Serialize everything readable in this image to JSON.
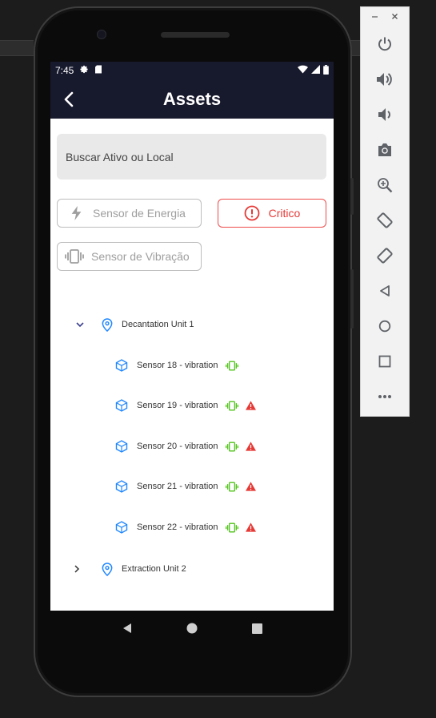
{
  "statusbar": {
    "time": "7:45"
  },
  "appbar": {
    "title": "Assets"
  },
  "search": {
    "placeholder": "Buscar Ativo ou Local"
  },
  "filters": {
    "energy_label": "Sensor de Energia",
    "critico_label": "Critico",
    "vibration_label": "Sensor de Vibração"
  },
  "tree": {
    "location1": "Decantation Unit 1",
    "sensors": [
      {
        "label": "Sensor 18 - vibration",
        "alert": false
      },
      {
        "label": "Sensor 19 - vibration",
        "alert": true
      },
      {
        "label": "Sensor 20 - vibration",
        "alert": true
      },
      {
        "label": "Sensor 21 - vibration",
        "alert": true
      },
      {
        "label": "Sensor 22 - vibration",
        "alert": true
      }
    ],
    "location2": "Extraction Unit 2"
  },
  "colors": {
    "appbar": "#17192d",
    "accent_blue": "#2188ff",
    "vibration_green": "#52c41a",
    "critical_red": "#e53935"
  },
  "icons": {
    "emulator_tools": [
      "power-icon",
      "volume-up-icon",
      "volume-down-icon",
      "camera-icon",
      "zoom-icon",
      "rotate-left-icon",
      "rotate-right-icon",
      "back-icon",
      "home-icon",
      "overview-icon",
      "more-icon"
    ]
  }
}
